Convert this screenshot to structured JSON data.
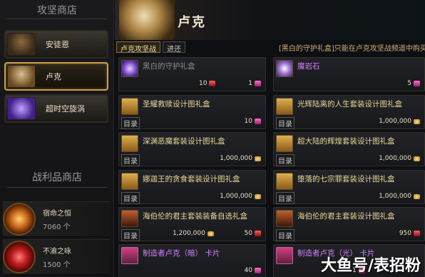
{
  "sidebar": {
    "attack_shop_title": "攻坚商店",
    "shops": [
      {
        "label": "安徒恩"
      },
      {
        "label": "卢克"
      },
      {
        "label": "超时空旋涡"
      }
    ],
    "loot_shop_title": "战利品商店",
    "loot": [
      {
        "name": "宿命之恒",
        "count": "7060 个"
      },
      {
        "name": "不渝之咏",
        "count": "1500 个"
      }
    ]
  },
  "header": {
    "hero_name": "卢克"
  },
  "tabs": [
    {
      "label": "卢克攻坚战"
    },
    {
      "label": "进还"
    }
  ],
  "notice": "[黑白的守护礼盒]只能在卢克攻坚战频道中购买",
  "items": [
    {
      "name": "黑白的守护礼盒",
      "price_left": "10",
      "price_right": "1",
      "mulu": ""
    },
    {
      "name": "魔岩石",
      "price_left": "",
      "price_right": "5",
      "mulu": ""
    },
    {
      "name": "圣耀救赎设计图礼盒",
      "price_left": "",
      "price_right": "10",
      "mulu": "目录"
    },
    {
      "name": "光辉陆离的人生套装设计图礼盒",
      "price_left": "",
      "price_right": "1,000,000",
      "mulu": "目录"
    },
    {
      "name": "深渊恶魔套装设计图礼盒",
      "price_left": "",
      "price_right": "1,000,000",
      "mulu": "目录"
    },
    {
      "name": "超大陆的辉煌套装设计图礼盒",
      "price_left": "",
      "price_right": "1,000,000",
      "mulu": "目录"
    },
    {
      "name": "娜迦王的贪食套装设计图礼盒",
      "price_left": "",
      "price_right": "1,000,000",
      "mulu": "目录"
    },
    {
      "name": "堕落的七宗罪套装设计图礼盒",
      "price_left": "",
      "price_right": "1,000,000",
      "mulu": "目录"
    },
    {
      "name": "海伯伦的君主套装装备自选礼盒",
      "price_left": "1,200,000",
      "price_right": "50",
      "mulu": "目录"
    },
    {
      "name": "海伯伦的君主套装设计图礼盒",
      "price_left": "",
      "price_right": "950",
      "mulu": "目录"
    },
    {
      "name": "制造者卢克（暗） 卡片",
      "price_left": "",
      "price_right": "40",
      "mulu": ""
    },
    {
      "name": "制造者卢克（光） 卡片",
      "price_left": "",
      "price_right": "1",
      "mulu": ""
    }
  ],
  "watermark": "大鱼号/表招粉",
  "colors": {
    "gold_text": "#e8d898",
    "purple_text": "#d080ff",
    "active_border": "#c9a04a"
  }
}
